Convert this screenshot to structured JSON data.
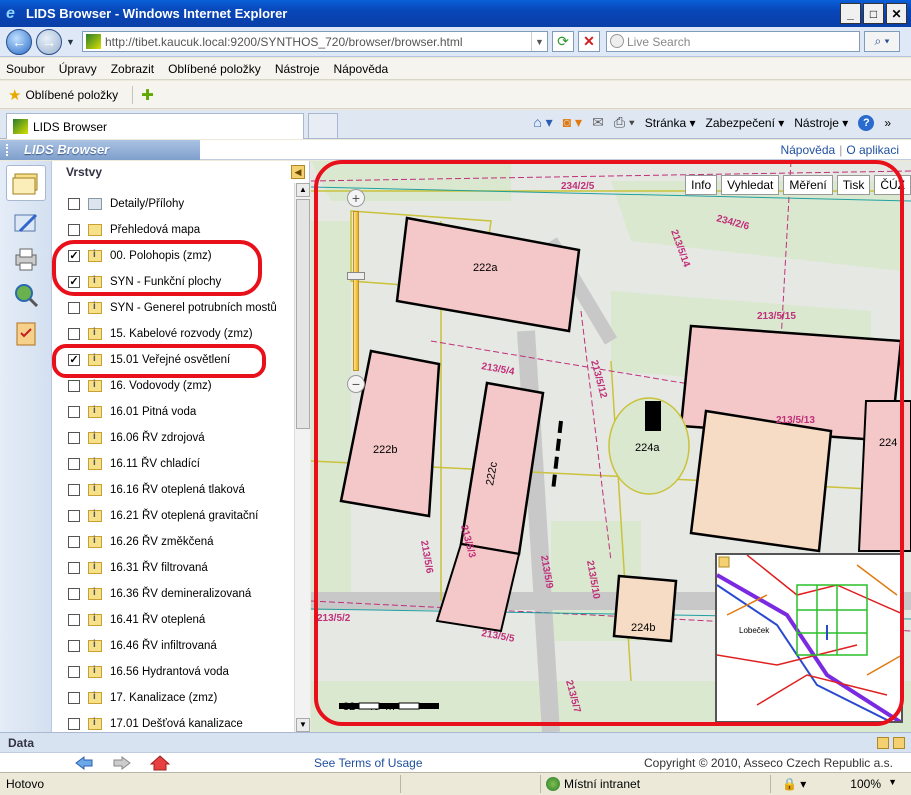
{
  "window": {
    "title": "LIDS Browser - Windows Internet Explorer"
  },
  "address": {
    "url": "http://tibet.kaucuk.local:9200/SYNTHOS_720/browser/browser.html",
    "search_placeholder": "Live Search"
  },
  "menu": [
    "Soubor",
    "Úpravy",
    "Zobrazit",
    "Oblíbené položky",
    "Nástroje",
    "Nápověda"
  ],
  "favorites": {
    "label": "Oblíbené položky"
  },
  "tab": {
    "title": "LIDS Browser"
  },
  "command_bar": {
    "page": "Stránka ▾",
    "security": "Zabezpečení ▾",
    "tools": "Nástroje ▾"
  },
  "app": {
    "brand": "LIDS Browser",
    "help": "Nápověda",
    "about": "O aplikaci"
  },
  "layers": {
    "title": "Vrstvy",
    "items": [
      {
        "label": "Detaily/Přílohy",
        "checked": false
      },
      {
        "label": "Přehledová mapa",
        "checked": false
      },
      {
        "label": "00. Polohopis (zmz)",
        "checked": true
      },
      {
        "label": "SYN - Funkční plochy",
        "checked": true
      },
      {
        "label": "SYN - Generel potrubních mostů",
        "checked": false
      },
      {
        "label": "15. Kabelové rozvody (zmz)",
        "checked": false
      },
      {
        "label": "15.01 Veřejné osvětlení",
        "checked": true
      },
      {
        "label": "16. Vodovody (zmz)",
        "checked": false
      },
      {
        "label": "16.01 Pitná voda",
        "checked": false
      },
      {
        "label": "16.06 ŘV zdrojová",
        "checked": false
      },
      {
        "label": "16.11 ŘV chladící",
        "checked": false
      },
      {
        "label": "16.16 ŘV oteplená tlaková",
        "checked": false
      },
      {
        "label": "16.21 ŘV oteplená gravitační",
        "checked": false
      },
      {
        "label": "16.26 ŘV změkčená",
        "checked": false
      },
      {
        "label": "16.31 ŘV filtrovaná",
        "checked": false
      },
      {
        "label": "16.36 ŘV demineralizovaná",
        "checked": false
      },
      {
        "label": "16.41 ŘV oteplená",
        "checked": false
      },
      {
        "label": "16.46 ŘV infiltrovaná",
        "checked": false
      },
      {
        "label": "16.56 Hydrantová voda",
        "checked": false
      },
      {
        "label": "17. Kanalizace (zmz)",
        "checked": false
      },
      {
        "label": "17.01 Dešťová kanalizace",
        "checked": false
      }
    ]
  },
  "map": {
    "tools": [
      "Info",
      "Vyhledat",
      "Měření",
      "Tisk",
      "ČÚZ"
    ],
    "zoom_in": "+",
    "zoom_out": "−",
    "scale_labels": [
      "32",
      "40",
      "m"
    ],
    "building_labels": [
      "222a",
      "222b",
      "222c",
      "224a",
      "224b",
      "224"
    ],
    "parcel_labels": [
      "234/2/5",
      "234/2/6",
      "213/5/14",
      "213/5/15",
      "213/5/13",
      "213/5/4",
      "213/5/12",
      "213/5/3",
      "213/5/9",
      "213/5/10",
      "213/5/5",
      "213/5/7",
      "213/5/2",
      "213/5/6"
    ],
    "overview_label": "Lobeček",
    "highlight_color": "#e8101a"
  },
  "data_panel": {
    "title": "Data"
  },
  "footer": {
    "terms": "See Terms of Usage",
    "copyright": "Copyright © 2010, Asseco Czech Republic a.s."
  },
  "status": {
    "text": "Hotovo",
    "zone": "Místní intranet",
    "zoom": "100%"
  }
}
